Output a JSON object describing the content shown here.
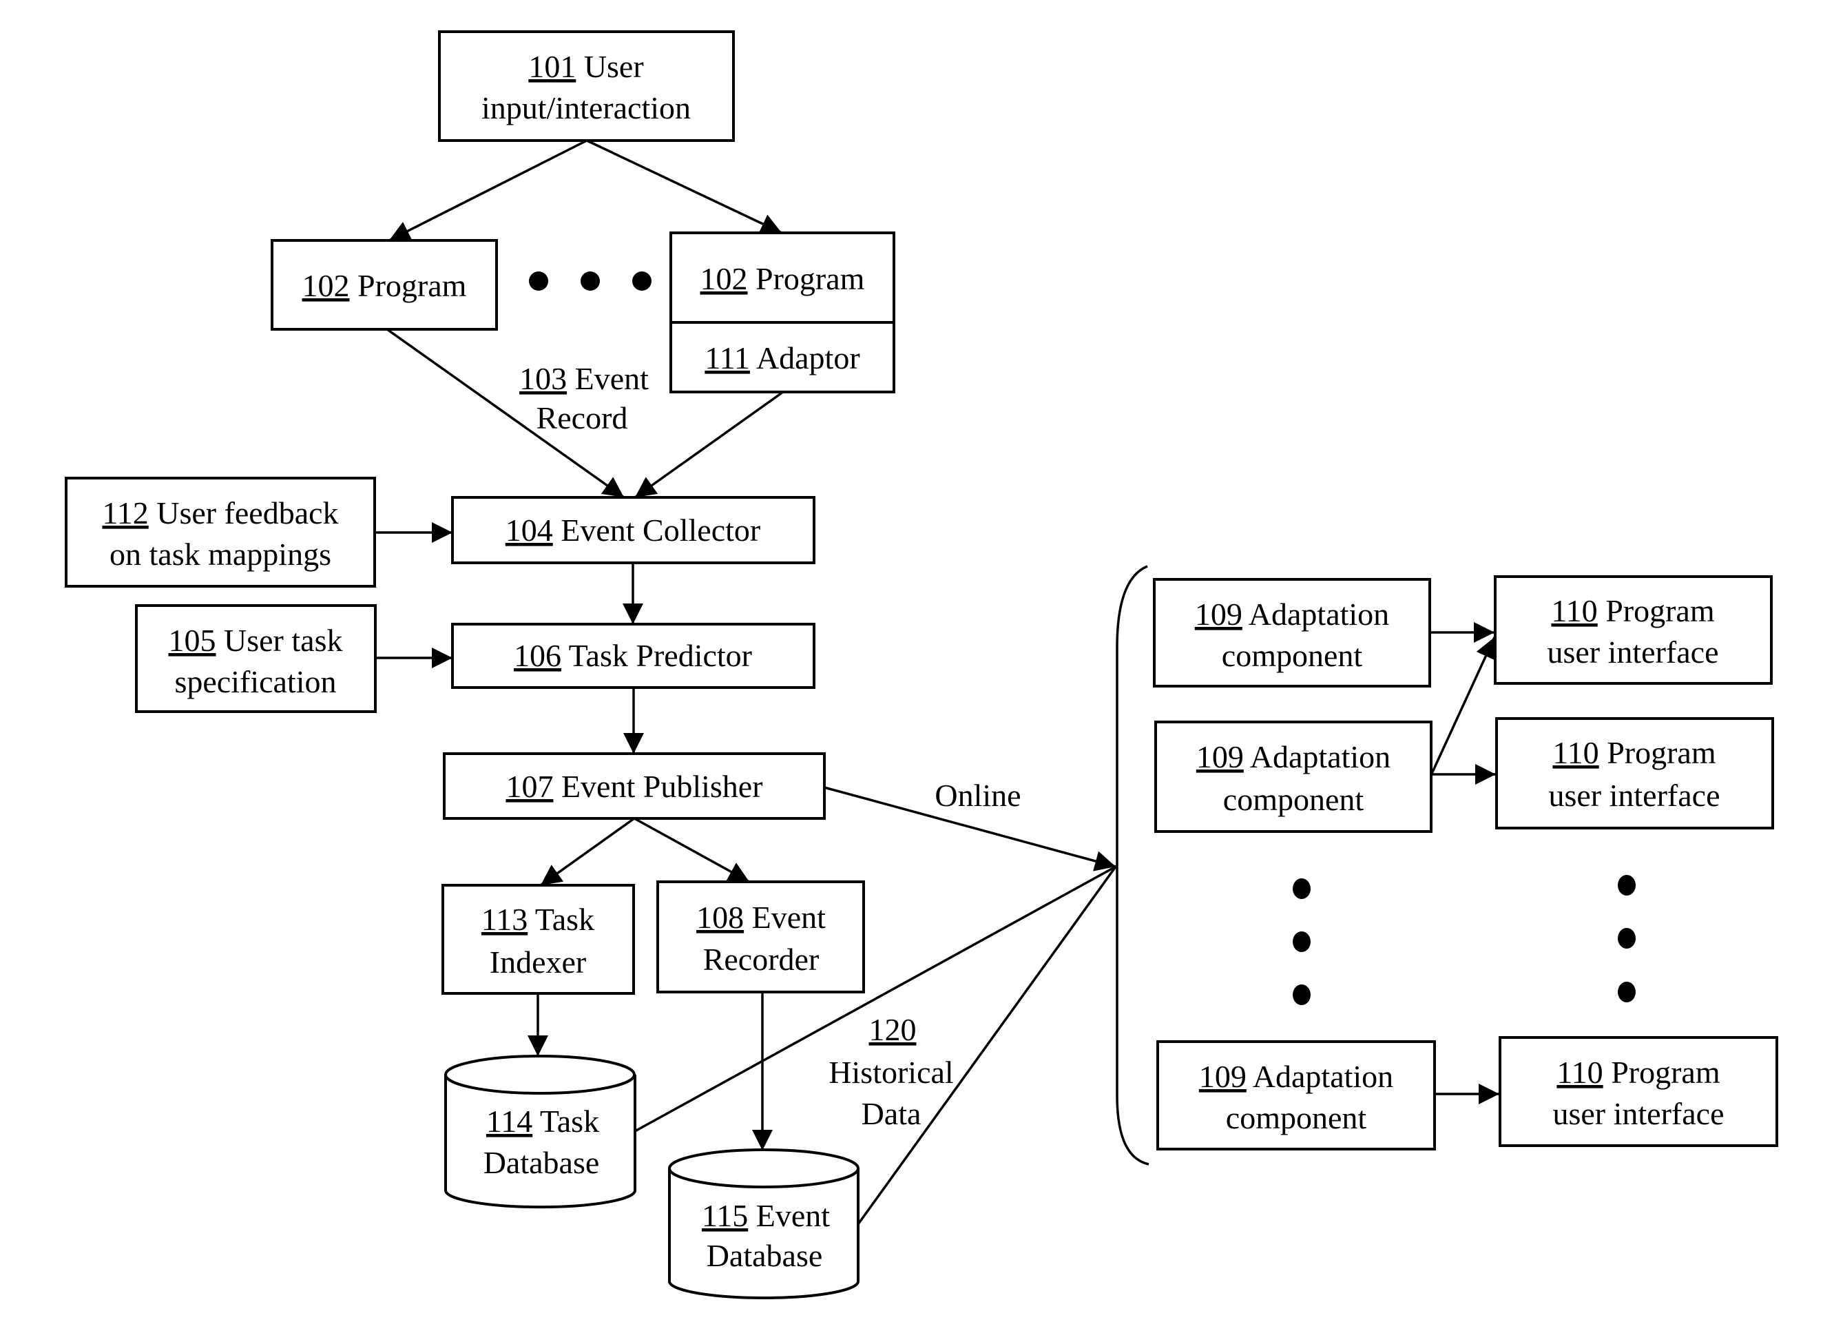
{
  "diagram": {
    "nodes": {
      "n101": {
        "num": "101",
        "line1": "User",
        "line2": "input/interaction"
      },
      "n102a": {
        "num": "102",
        "line1": "Program"
      },
      "n102b": {
        "num": "102",
        "line1": "Program"
      },
      "n111": {
        "num": "111",
        "line1": "Adaptor"
      },
      "n104": {
        "num": "104",
        "line1": "Event Collector"
      },
      "n112": {
        "num": "112",
        "line1": "User feedback",
        "line2": "on task mappings"
      },
      "n105": {
        "num": "105",
        "line1": "User task",
        "line2": "specification"
      },
      "n106": {
        "num": "106",
        "line1": "Task Predictor"
      },
      "n107": {
        "num": "107",
        "line1": "Event Publisher"
      },
      "n113": {
        "num": "113",
        "line1": "Task",
        "line2": "Indexer"
      },
      "n108": {
        "num": "108",
        "line1": "Event",
        "line2": "Recorder"
      },
      "n114": {
        "num": "114",
        "line1": "Task",
        "line2": "Database"
      },
      "n115": {
        "num": "115",
        "line1": "Event",
        "line2": "Database"
      },
      "n109a": {
        "num": "109",
        "line1": "Adaptation",
        "line2": "component"
      },
      "n109b": {
        "num": "109",
        "line1": "Adaptation",
        "line2": "component"
      },
      "n109c": {
        "num": "109",
        "line1": "Adaptation",
        "line2": "component"
      },
      "n110a": {
        "num": "110",
        "line1": "Program",
        "line2": "user interface"
      },
      "n110b": {
        "num": "110",
        "line1": "Program",
        "line2": "user interface"
      },
      "n110c": {
        "num": "110",
        "line1": "Program",
        "line2": "user interface"
      }
    },
    "edge_labels": {
      "event_record": {
        "num": "103",
        "line1": "Event",
        "line2": "Record"
      },
      "online": "Online",
      "historical": {
        "num": "120",
        "line1": "Historical",
        "line2": "Data"
      }
    },
    "edges": [
      {
        "from": "101",
        "to": "102 Program (left)"
      },
      {
        "from": "101",
        "to": "102 Program (right)"
      },
      {
        "from": "102 Program (left)",
        "to": "104",
        "label": "103 Event Record"
      },
      {
        "from": "111",
        "to": "104"
      },
      {
        "from": "112",
        "to": "104"
      },
      {
        "from": "104",
        "to": "106"
      },
      {
        "from": "105",
        "to": "106"
      },
      {
        "from": "106",
        "to": "107"
      },
      {
        "from": "107",
        "to": "113"
      },
      {
        "from": "107",
        "to": "108"
      },
      {
        "from": "107",
        "to": "109 group",
        "label": "Online"
      },
      {
        "from": "113",
        "to": "114"
      },
      {
        "from": "108",
        "to": "115"
      },
      {
        "from": "114",
        "to": "109 group"
      },
      {
        "from": "115",
        "to": "109 group",
        "label": "120 Historical Data"
      },
      {
        "from": "109 (1)",
        "to": "110 (1)"
      },
      {
        "from": "109 (2)",
        "to": "110 (1)"
      },
      {
        "from": "109 (2)",
        "to": "110 (2)"
      },
      {
        "from": "109 (n)",
        "to": "110 (n)"
      }
    ]
  }
}
